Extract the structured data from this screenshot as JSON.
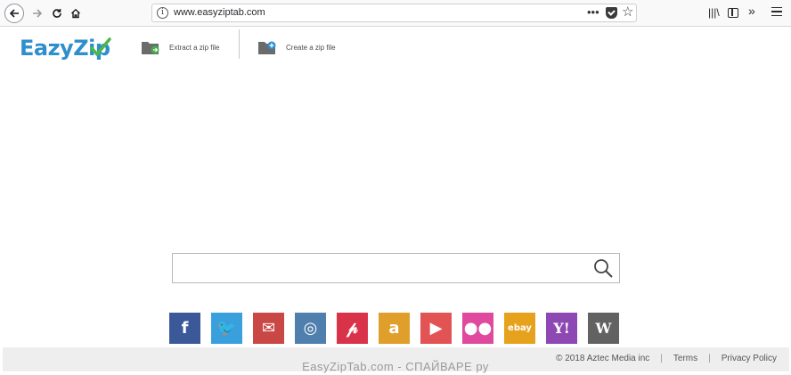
{
  "browser": {
    "url": "www.easyziptab.com",
    "info_glyph": "i",
    "more_glyph": "•••",
    "star_glyph": "☆",
    "library_glyph": "|||\\",
    "overflow_glyph": "»"
  },
  "header": {
    "logo_text": "EazyZip",
    "extract_label": "Extract a zip file",
    "create_label": "Create a zip file"
  },
  "search": {
    "value": "",
    "placeholder": ""
  },
  "socials": [
    {
      "icon": "facebook-icon",
      "glyph": "f",
      "color": "#3b5998"
    },
    {
      "icon": "twitter-icon",
      "glyph": "🐦",
      "color": "#3a9fdd"
    },
    {
      "icon": "gmail-icon",
      "glyph": "✉",
      "color": "#c94744"
    },
    {
      "icon": "instagram-icon",
      "glyph": "◎",
      "color": "#4f7fad"
    },
    {
      "icon": "pinterest-icon",
      "glyph": "𝓅",
      "color": "#d9334a"
    },
    {
      "icon": "amazon-icon",
      "glyph": "a",
      "color": "#e09f2b"
    },
    {
      "icon": "youtube-icon",
      "glyph": "▶",
      "color": "#e25454"
    },
    {
      "icon": "flickr-icon",
      "glyph": "●●",
      "color": "#e04a9e"
    },
    {
      "icon": "ebay-icon",
      "glyph": "ebay",
      "color": "#e6a11d"
    },
    {
      "icon": "yahoo-icon",
      "glyph": "Y!",
      "color": "#8d48b3"
    },
    {
      "icon": "wikipedia-icon",
      "glyph": "W",
      "color": "#626262"
    }
  ],
  "footer": {
    "copyright": "© 2018 Aztec Media inc",
    "terms": "Terms",
    "privacy": "Privacy Policy",
    "separator": "|"
  },
  "watermark": "EasyZipTab.com - СПАЙВАРЕ ру"
}
